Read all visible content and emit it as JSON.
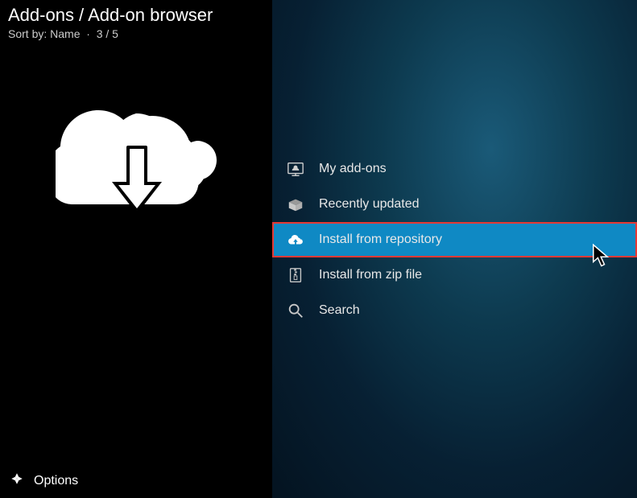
{
  "header": {
    "title": "Add-ons / Add-on browser",
    "sort_label": "Sort by: Name",
    "position": "3 / 5"
  },
  "menu": {
    "items": [
      {
        "label": "My add-ons"
      },
      {
        "label": "Recently updated"
      },
      {
        "label": "Install from repository"
      },
      {
        "label": "Install from zip file"
      },
      {
        "label": "Search"
      }
    ]
  },
  "footer": {
    "options_label": "Options"
  }
}
